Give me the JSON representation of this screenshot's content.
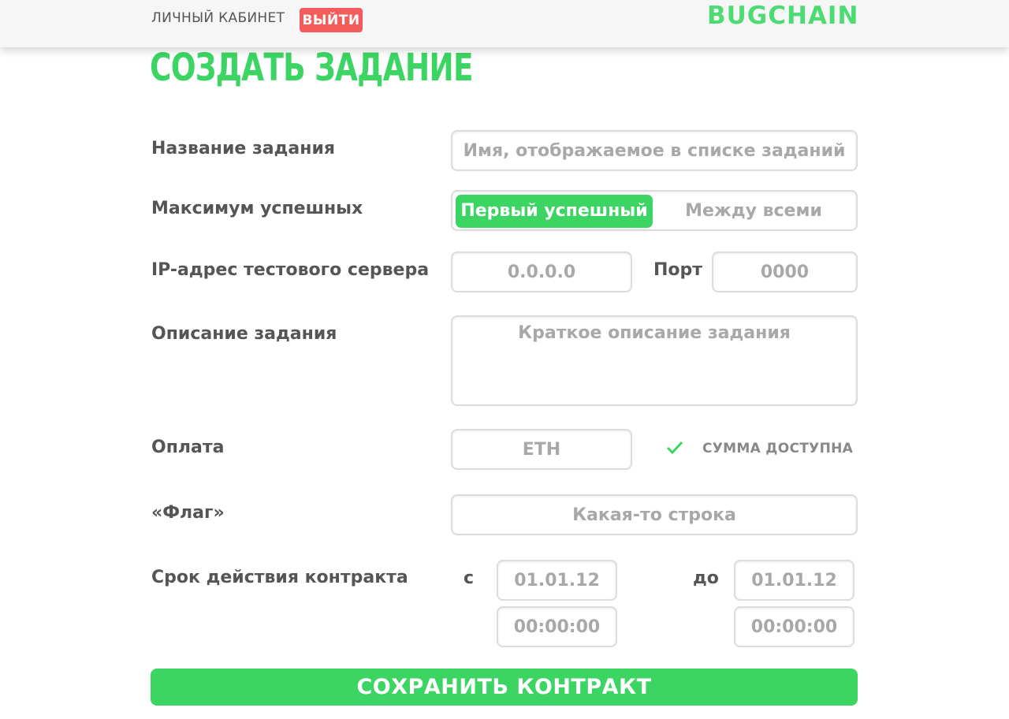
{
  "header": {
    "account_label": "ЛИЧНЫЙ КАБИНЕТ",
    "logout_label": "ВЫЙТИ",
    "logo": "BUGCHAIN"
  },
  "page": {
    "title": "СОЗДАТЬ ЗАДАНИЕ"
  },
  "form": {
    "task_name": {
      "label": "Название задания",
      "placeholder": "Имя, отображаемое в списке заданий"
    },
    "max_success": {
      "label": "Максимум успешных",
      "option_first": "Первый успешный",
      "option_all": "Между всеми",
      "selected": "Первый успешный"
    },
    "server": {
      "ip_label": "IP-адрес тестового сервера",
      "ip_placeholder": "0.0.0.0",
      "port_label": "Порт",
      "port_placeholder": "0000"
    },
    "description": {
      "label": "Описание задания",
      "placeholder": "Краткое описание задания"
    },
    "payment": {
      "label": "Оплата",
      "placeholder": "ETH",
      "status": "СУММА ДОСТУПНА"
    },
    "flag": {
      "label": "«Флаг»",
      "placeholder": "Какая-то строка"
    },
    "term": {
      "label": "Срок действия контракта",
      "from_label": "с",
      "to_label": "до",
      "from_date_placeholder": "01.01.12",
      "from_time_placeholder": "00:00:00",
      "to_date_placeholder": "01.01.12",
      "to_time_placeholder": "00:00:00"
    }
  },
  "actions": {
    "save_label": "СОХРАНИТЬ КОНТРАКТ"
  },
  "colors": {
    "accent": "#3cd563",
    "danger": "#f45b5b",
    "text": "#555555",
    "placeholder": "#a8a8a8"
  },
  "icons": {
    "payment_status": "check-icon"
  }
}
